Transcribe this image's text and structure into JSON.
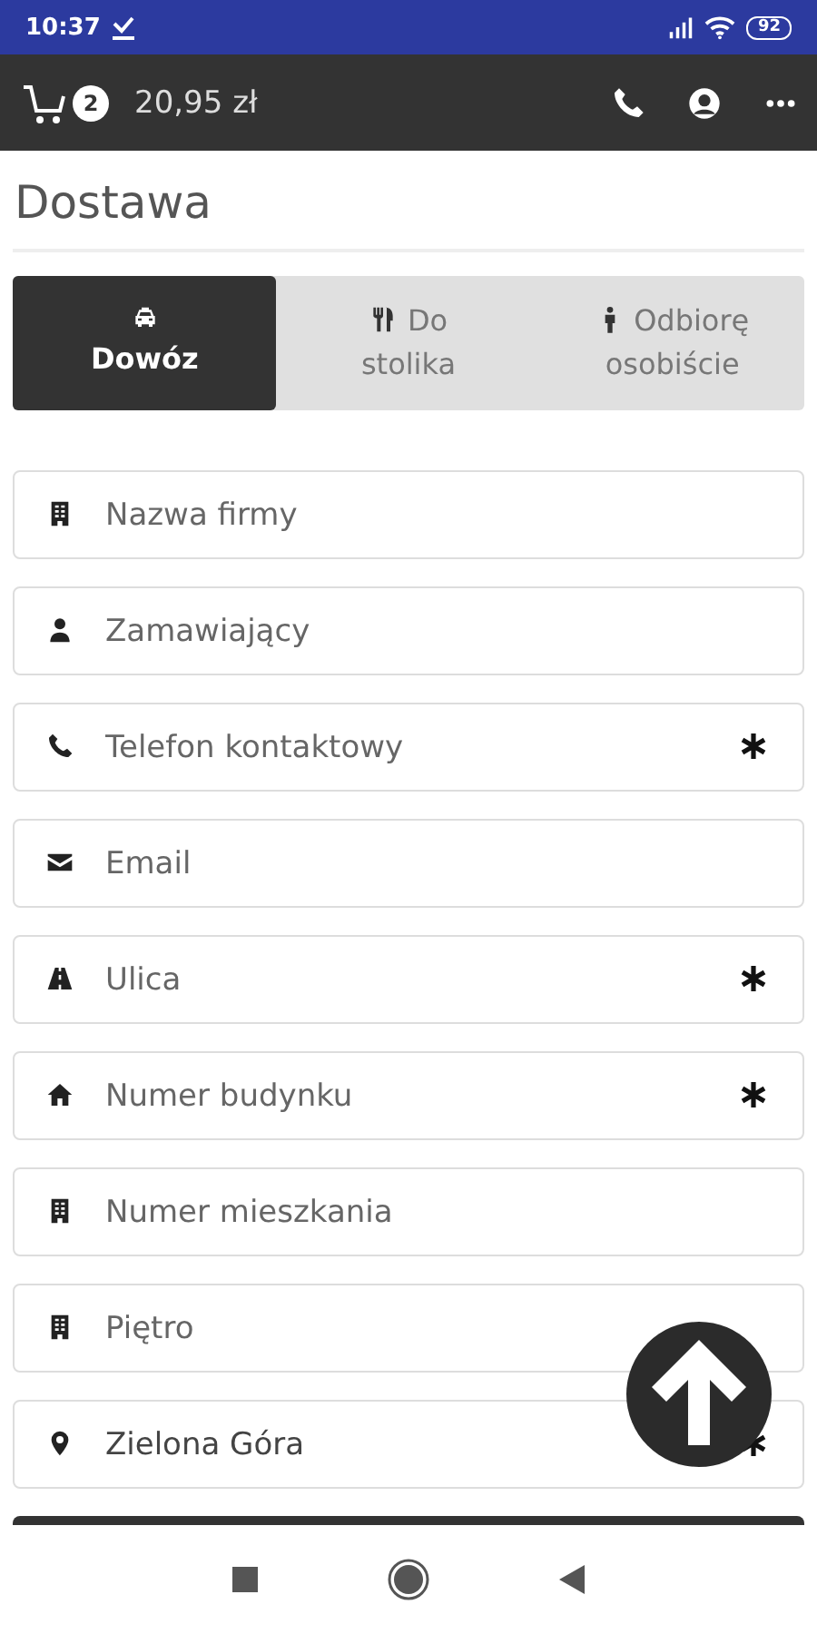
{
  "status_bar": {
    "time": "10:37",
    "battery": "92"
  },
  "header": {
    "cart_count": "2",
    "total": "20,95 zł"
  },
  "title": "Dostawa",
  "tabs": [
    {
      "label": "Dowóz",
      "kind": "delivery",
      "selected": true
    },
    {
      "label": "Do stolika",
      "kind": "table",
      "selected": false
    },
    {
      "label": "Odbiorę osobiście",
      "kind": "pickup",
      "selected": false
    }
  ],
  "fields": [
    {
      "placeholder": "Nazwa firmy",
      "kind": "company",
      "required": false
    },
    {
      "placeholder": "Zamawiający",
      "kind": "person",
      "required": false
    },
    {
      "placeholder": "Telefon kontaktowy",
      "kind": "phone",
      "required": true
    },
    {
      "placeholder": "Email",
      "kind": "email",
      "required": false
    },
    {
      "placeholder": "Ulica",
      "kind": "street",
      "required": true
    },
    {
      "placeholder": "Numer budynku",
      "kind": "building",
      "required": true
    },
    {
      "placeholder": "Numer mieszkania",
      "kind": "flat",
      "required": false
    },
    {
      "placeholder": "Piętro",
      "kind": "floor",
      "required": false
    },
    {
      "value": "Zielona Góra",
      "kind": "city",
      "required": true
    }
  ]
}
